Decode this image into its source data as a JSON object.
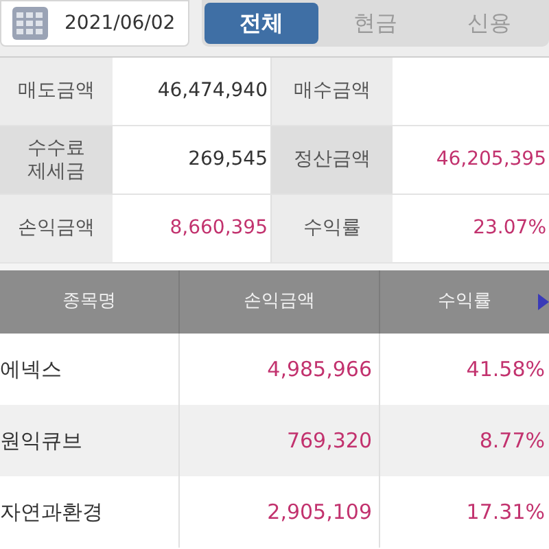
{
  "date": "2021/06/02",
  "tabs": [
    {
      "label": "전체",
      "selected": true
    },
    {
      "label": "현금",
      "selected": false
    },
    {
      "label": "신용",
      "selected": false
    }
  ],
  "summary": [
    [
      {
        "label": "매도금액",
        "value": "46,474,940",
        "highlight": false
      },
      {
        "label": "매수금액"
      }
    ],
    [
      {
        "label": "수수료\n제세금",
        "value": "269,545",
        "highlight": false
      },
      {
        "label": "정산금액",
        "value": "46,205,395",
        "highlight": true
      }
    ],
    [
      {
        "label": "손익금액",
        "value": "8,660,395",
        "highlight": true
      },
      {
        "label": "수익률",
        "value": "23.07%",
        "highlight": true
      }
    ]
  ],
  "table": {
    "columns": [
      "종목명",
      "손익금액",
      "수익률"
    ],
    "rows": [
      {
        "name": "에넥스",
        "profit": "4,985,966",
        "rate": "41.58%"
      },
      {
        "name": "원익큐브",
        "profit": "769,320",
        "rate": "8.77%"
      },
      {
        "name": "자연과환경",
        "profit": "2,905,109",
        "rate": "17.31%"
      }
    ]
  }
}
